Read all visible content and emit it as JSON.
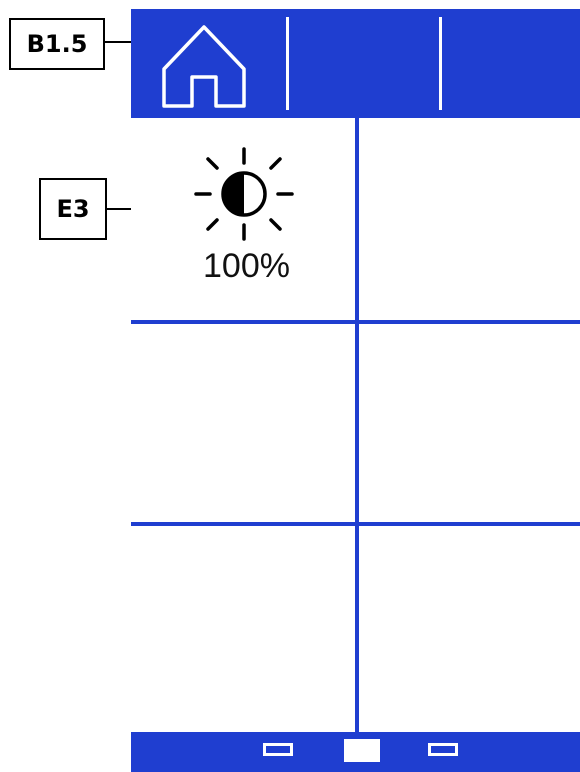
{
  "callouts": {
    "home": "B1.5",
    "brightness": "E3"
  },
  "header": {
    "home_icon": "home-icon"
  },
  "tiles": {
    "brightness": {
      "icon": "brightness-icon",
      "value": "100%"
    }
  },
  "pager": {
    "pages": [
      {
        "active": false
      },
      {
        "active": true
      },
      {
        "active": false
      }
    ]
  },
  "colors": {
    "accent": "#1f3ed0",
    "background": "#ffffff",
    "text": "#111111"
  }
}
